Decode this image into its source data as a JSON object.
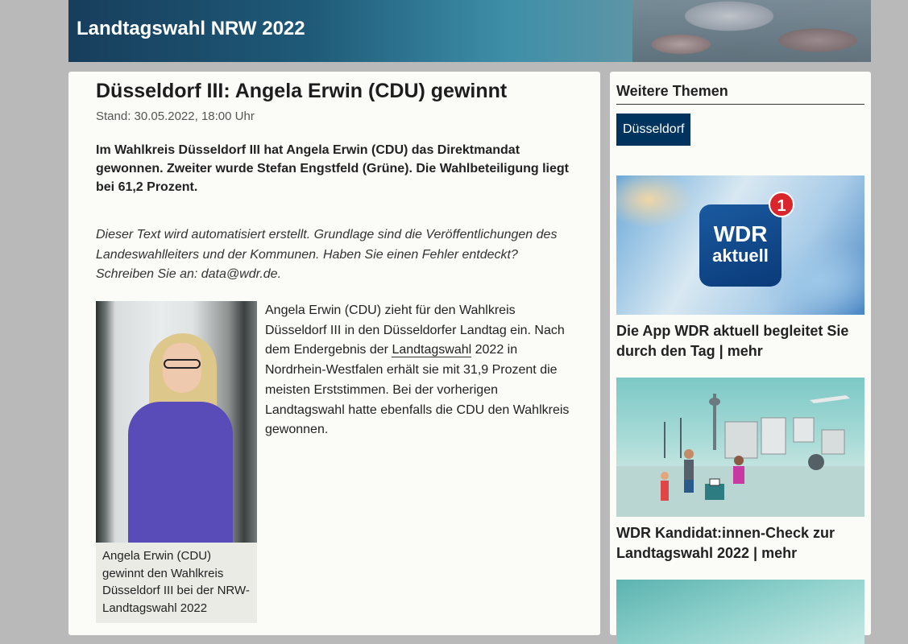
{
  "header": {
    "title": "Landtagswahl NRW 2022"
  },
  "article": {
    "title": "Düsseldorf III: Angela Erwin (CDU) gewinnt",
    "stand": "Stand: 30.05.2022, 18:00 Uhr",
    "lead": "Im Wahlkreis Düsseldorf III hat Angela Erwin (CDU) das Direktmandat gewonnen. Zweiter wurde Stefan Engstfeld (Grüne). Die Wahlbeteiligung liegt bei 61,2 Prozent.",
    "note": "Dieser Text wird automatisiert erstellt. Grundlage sind die Veröffentlichungen des Landeswahlleiters und der Kommunen. Haben Sie einen Fehler entdeckt? Schreiben Sie an: data@wdr.de.",
    "image_caption": "Angela Erwin (CDU) gewinnt den Wahlkreis Düsseldorf III bei der NRW-Landtagswahl 2022",
    "body_before_link": "Angela Erwin (CDU) zieht für den Wahlkreis Düsseldorf III in den Düsseldorfer Landtag ein. Nach dem Endergebnis der ",
    "body_link": "Landtagswahl",
    "body_after_link": " 2022 in Nordrhein-Westfalen erhält sie mit 31,9 Prozent die meisten Erststimmen. Bei der vorherigen Landtagswahl hatte ebenfalls die CDU den Wahlkreis gewonnen."
  },
  "sidebar": {
    "heading": "Weitere Themen",
    "tag": "Düsseldorf",
    "teasers": [
      {
        "title": "Die App WDR aktuell begleitet Sie durch den Tag | mehr",
        "icon_line1": "WDR",
        "icon_line2": "aktuell",
        "badge": "1"
      },
      {
        "title": "WDR Kandidat:innen-Check zur Landtagswahl 2022 | mehr"
      }
    ]
  }
}
